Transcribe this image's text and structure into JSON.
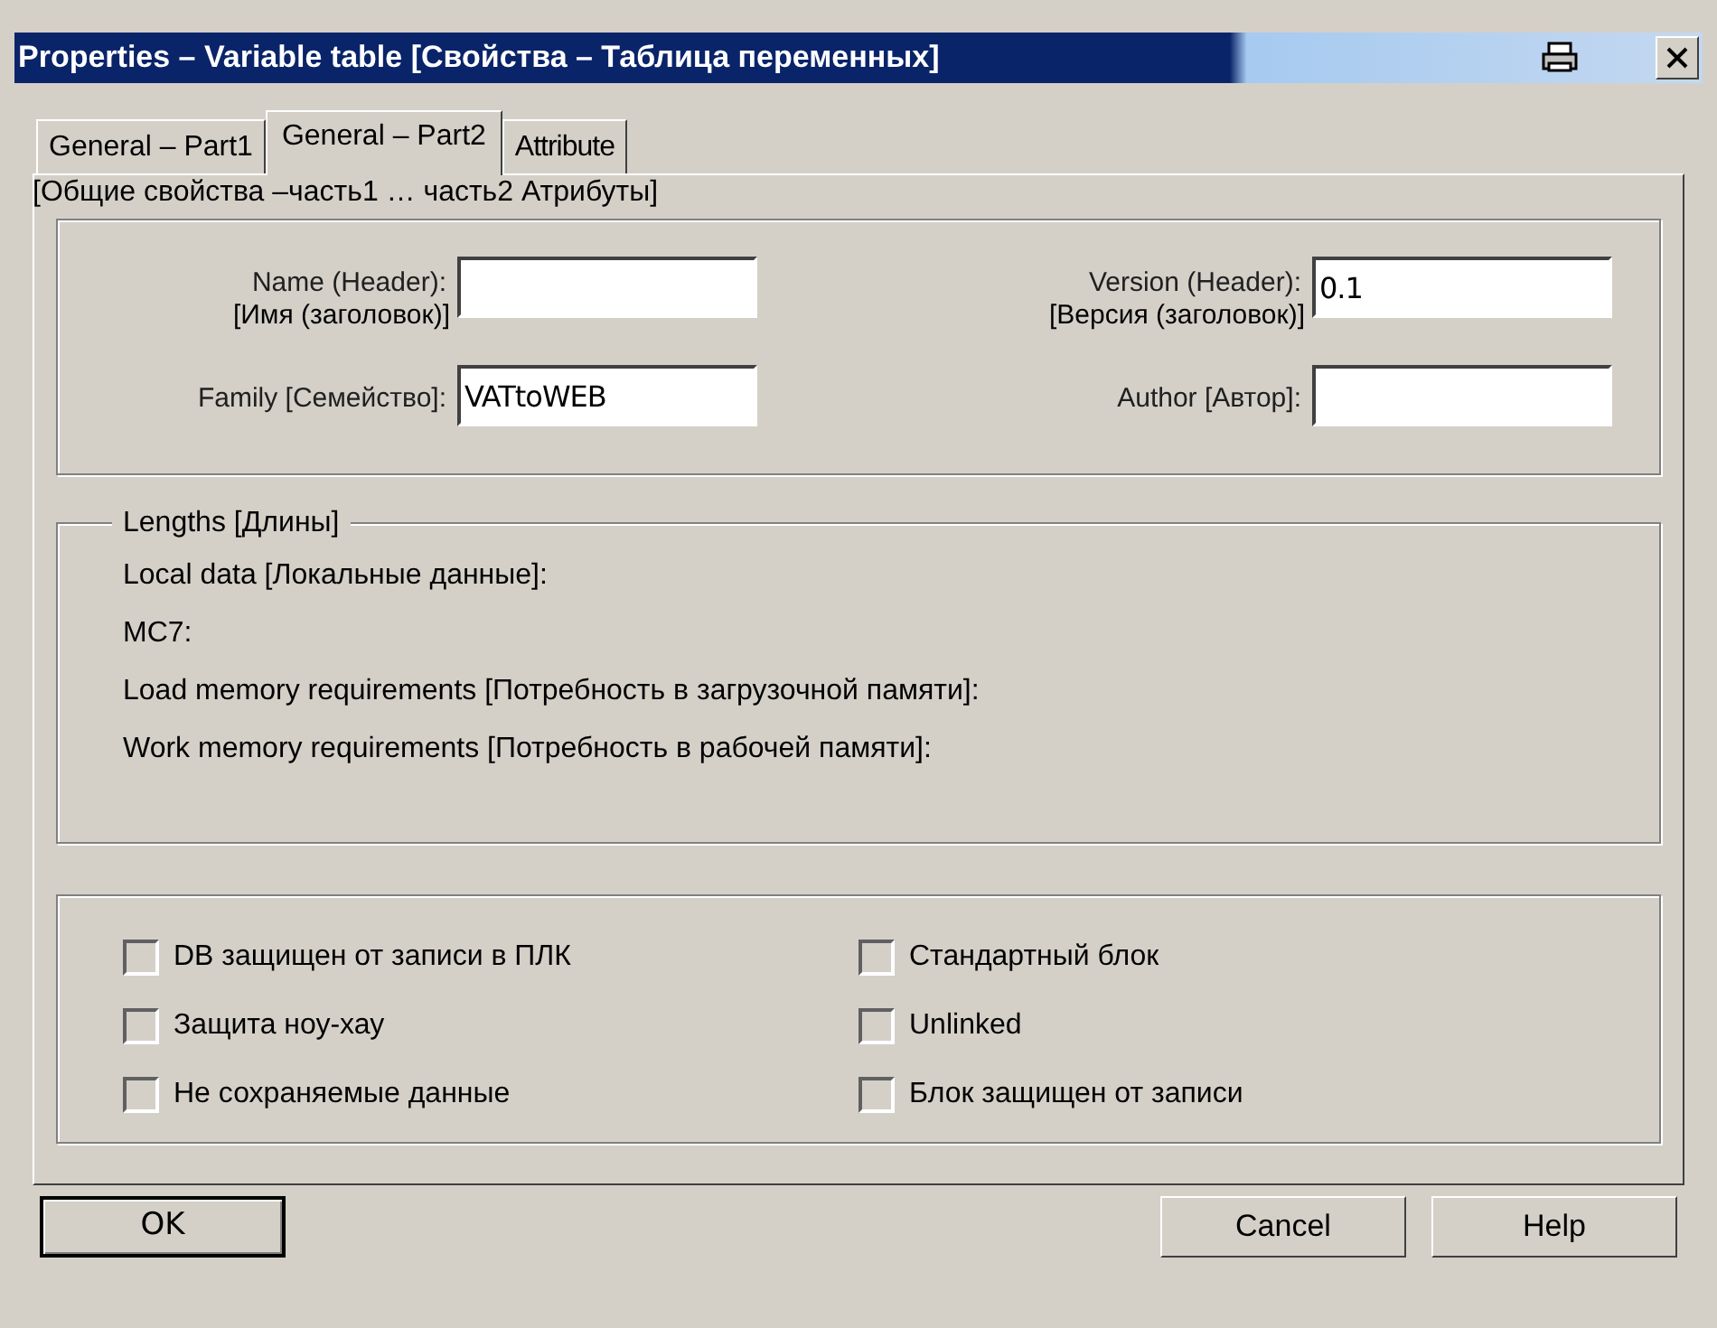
{
  "window": {
    "title": "Properties – Variable table [Свойства – Таблица переменных]"
  },
  "tabs": [
    {
      "label": "General – Part1",
      "selected": false
    },
    {
      "label": "General – Part2",
      "selected": true
    },
    {
      "label": "Attribute",
      "selected": false
    }
  ],
  "tab_caption": "[Общие свойства –часть1 … часть2  Атрибуты]",
  "header_fields": [
    {
      "label": "Name (Header):",
      "sublabel": "[Имя (заголовок)]"
    },
    {
      "label": "Version (Header):",
      "sublabel": "[Версия (заголовок)]",
      "value": "0.1"
    },
    {
      "label": "Family [Семейство]:",
      "value": "VATtoWEB"
    },
    {
      "label": "Author [Автор]:"
    }
  ],
  "lengths": {
    "title": "Lengths [Длины]",
    "rows": [
      "Local data [Локальные данные]:",
      "MC7:",
      "Load memory requirements [Потребность в загрузочной памяти]:",
      "Work memory requirements [Потребность в рабочей памяти]:"
    ]
  },
  "checkboxes": [
    {
      "label": "DB защищен от записи в ПЛК",
      "checked": false
    },
    {
      "label": "Стандартный блок",
      "checked": false
    },
    {
      "label": "Защита ноу-хау",
      "checked": false
    },
    {
      "label": "Unlinked",
      "checked": false
    },
    {
      "label": "Не сохраняемые данные",
      "checked": false
    },
    {
      "label": "Блок защищен от записи",
      "checked": false
    }
  ],
  "buttons": [
    {
      "label": "OK",
      "default": true
    },
    {
      "label": "Cancel",
      "default": false
    },
    {
      "label": "Help",
      "default": false
    }
  ]
}
